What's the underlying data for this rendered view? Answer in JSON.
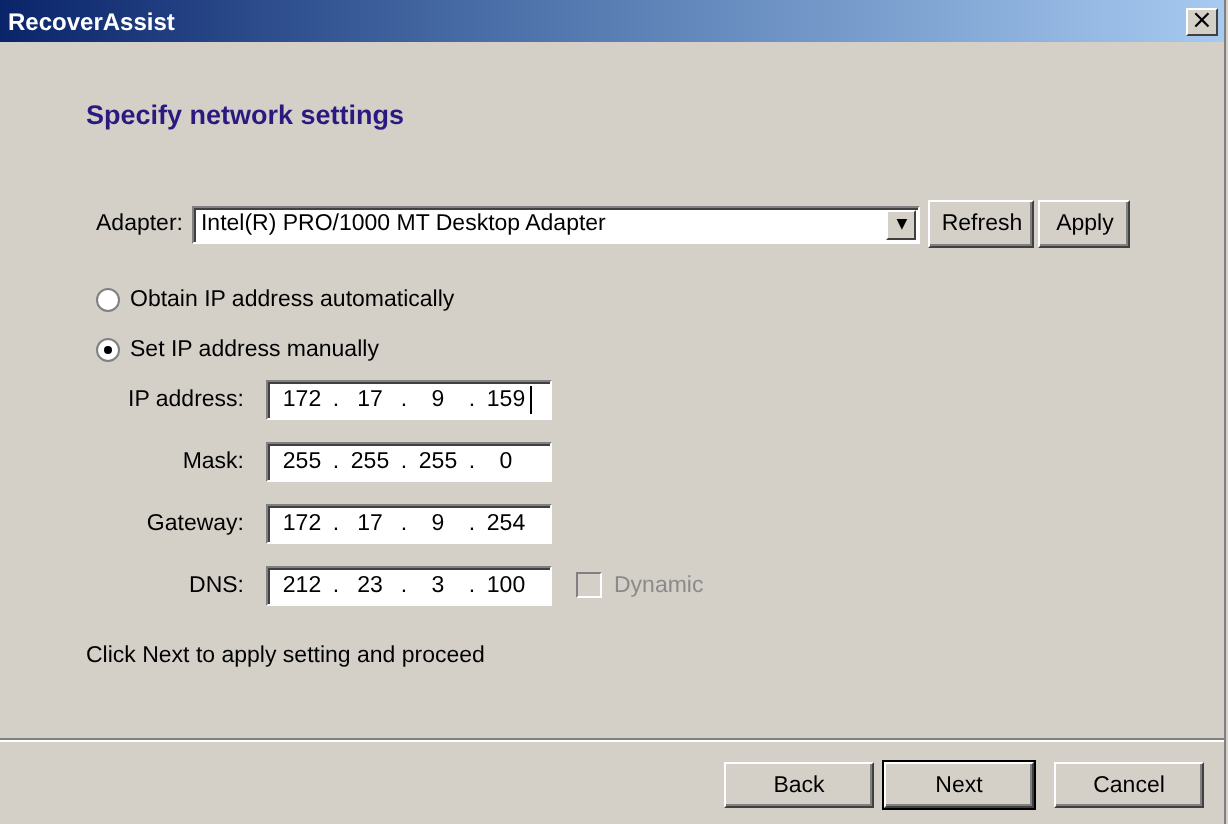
{
  "window": {
    "title": "RecoverAssist",
    "close": "×"
  },
  "heading": "Specify network settings",
  "adapter": {
    "label": "Adapter:",
    "value": "Intel(R) PRO/1000 MT Desktop Adapter",
    "arrow": "▼",
    "buttons": [
      "Refresh",
      "Apply"
    ]
  },
  "modes": [
    {
      "label": "Obtain IP address automatically",
      "selected": false
    },
    {
      "label": "Set IP address manually",
      "selected": true
    }
  ],
  "fields": [
    {
      "label": "IP address:",
      "octets": [
        "172",
        "17",
        "9",
        "159"
      ],
      "separator": ".",
      "focused": true
    },
    {
      "label": "Mask:",
      "octets": [
        "255",
        "255",
        "255",
        "0"
      ],
      "separator": ".",
      "focused": false
    },
    {
      "label": "Gateway:",
      "octets": [
        "172",
        "17",
        "9",
        "254"
      ],
      "separator": ".",
      "focused": false
    },
    {
      "label": "DNS:",
      "octets": [
        "212",
        "23",
        "3",
        "100"
      ],
      "separator": ".",
      "focused": false,
      "option": {
        "label": "Dynamic",
        "checked": false,
        "disabled": true
      }
    }
  ],
  "hint": "Click Next to apply setting and proceed",
  "buttons": [
    {
      "label": "Back",
      "default": false
    },
    {
      "label": "Next",
      "default": true
    },
    {
      "label": "Cancel",
      "default": false
    }
  ]
}
